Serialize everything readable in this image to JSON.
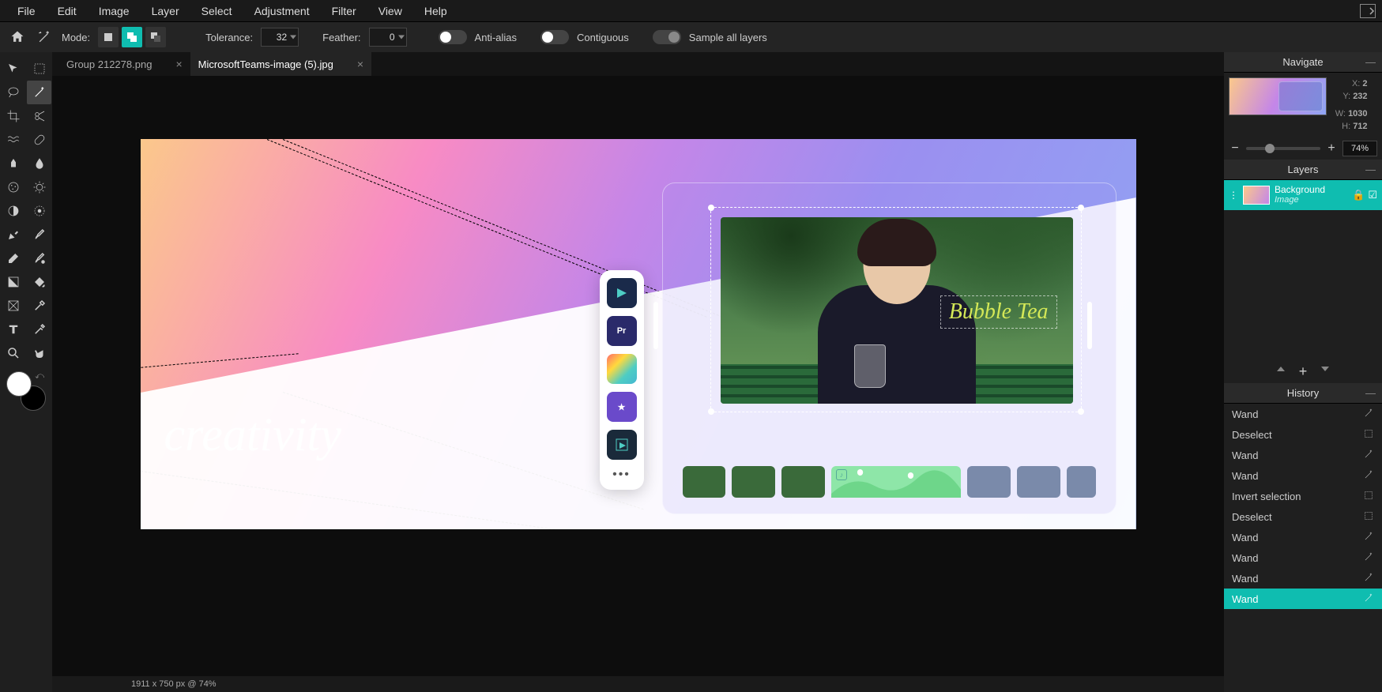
{
  "menubar": [
    "File",
    "Edit",
    "Image",
    "Layer",
    "Select",
    "Adjustment",
    "Filter",
    "View",
    "Help"
  ],
  "options": {
    "mode_label": "Mode:",
    "tolerance_label": "Tolerance:",
    "tolerance_value": "32",
    "feather_label": "Feather:",
    "feather_value": "0",
    "antialias_label": "Anti-alias",
    "contiguous_label": "Contiguous",
    "sample_all_label": "Sample all layers",
    "antialias_on": true,
    "contiguous_on": true,
    "sample_all_on": false
  },
  "tabs": [
    {
      "name": "Group 212278.png",
      "active": false
    },
    {
      "name": "MicrosoftTeams-image (5).jpg",
      "active": true
    }
  ],
  "canvas_text": {
    "creativity": "creativity",
    "bubble": "Bubble Tea"
  },
  "app_icons": [
    {
      "name": "filmora",
      "bg": "#1a2a4a",
      "txt": ""
    },
    {
      "name": "premiere",
      "bg": "#2a2a6a",
      "txt": "Pr"
    },
    {
      "name": "finalcut",
      "bg": "linear-gradient(135deg,#ff6b6b,#4ecdc4,#45b7d1)",
      "txt": ""
    },
    {
      "name": "imovie",
      "bg": "#6a4aca",
      "txt": "★"
    },
    {
      "name": "other",
      "bg": "#1a2a3a",
      "txt": ""
    }
  ],
  "statusbar": "1911 x 750 px @ 74%",
  "navigate": {
    "title": "Navigate",
    "x_label": "X:",
    "x_val": "2",
    "y_label": "Y:",
    "y_val": "232",
    "w_label": "W:",
    "w_val": "1030",
    "h_label": "H:",
    "h_val": "712",
    "zoom": "74%"
  },
  "layers": {
    "title": "Layers",
    "items": [
      {
        "name": "Background",
        "type": "Image"
      }
    ]
  },
  "history": {
    "title": "History",
    "items": [
      {
        "name": "Wand",
        "icon": "wand"
      },
      {
        "name": "Deselect",
        "icon": "deselect"
      },
      {
        "name": "Wand",
        "icon": "wand"
      },
      {
        "name": "Wand",
        "icon": "wand"
      },
      {
        "name": "Invert selection",
        "icon": "deselect"
      },
      {
        "name": "Deselect",
        "icon": "deselect"
      },
      {
        "name": "Wand",
        "icon": "wand"
      },
      {
        "name": "Wand",
        "icon": "wand"
      },
      {
        "name": "Wand",
        "icon": "wand"
      },
      {
        "name": "Wand",
        "icon": "wand",
        "active": true
      }
    ]
  }
}
